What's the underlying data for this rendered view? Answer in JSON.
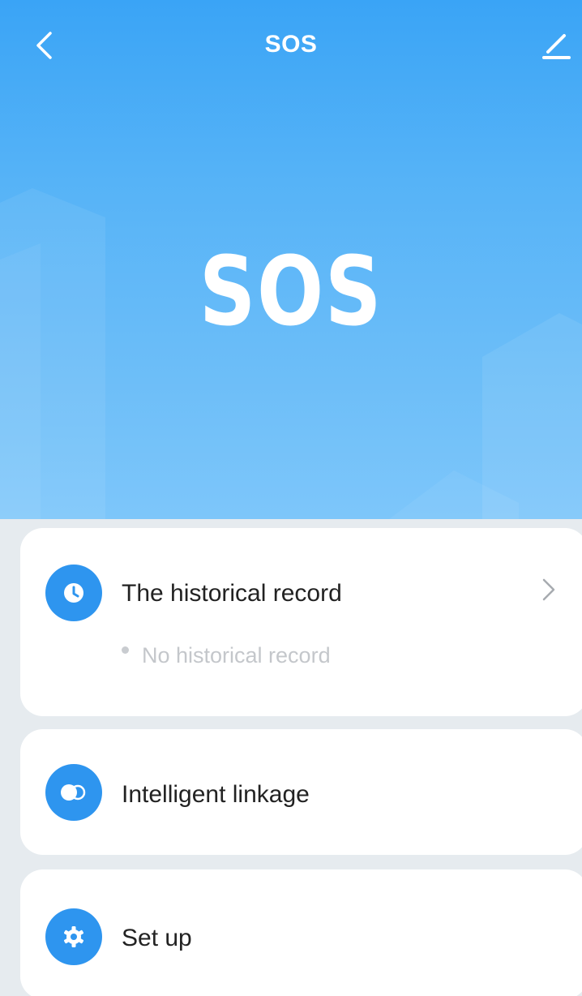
{
  "header": {
    "title": "SOS",
    "back_icon": "chevron-left-icon",
    "edit_icon": "pencil-icon"
  },
  "hero": {
    "label": "SOS"
  },
  "history_card": {
    "icon": "clock-icon",
    "title": "The historical record",
    "chevron_icon": "chevron-right-icon",
    "empty_text": "No historical record"
  },
  "linkage_card": {
    "icon": "toggle-icon",
    "title": "Intelligent linkage"
  },
  "setup_card": {
    "icon": "gear-icon",
    "title": "Set up"
  },
  "colors": {
    "hero_top": "#3aa4f6",
    "hero_bottom": "#7dc6fa",
    "accent": "#2e95ef",
    "background": "#e6ebef",
    "card": "#ffffff"
  }
}
